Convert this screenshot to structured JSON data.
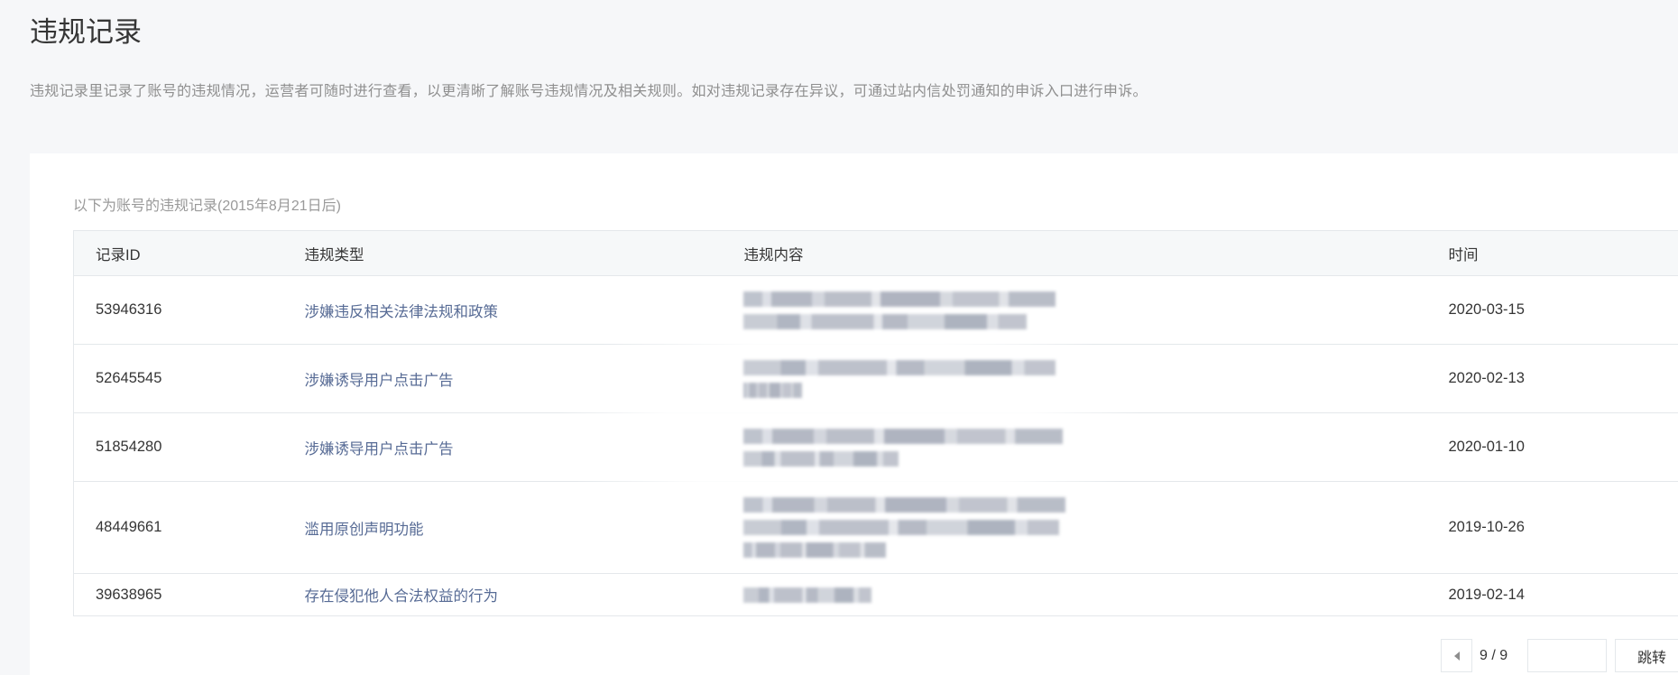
{
  "page": {
    "title": "违规记录",
    "description": "违规记录里记录了账号的违规情况，运营者可随时进行查看，以更清晰了解账号违规情况及相关规则。如对违规记录存在异议，可通过站内信处罚通知的申诉入口进行申诉。"
  },
  "records": {
    "caption": "以下为账号的违规记录(2015年8月21日后)",
    "columns": [
      "记录ID",
      "违规类型",
      "违规内容",
      "时间"
    ],
    "rows": [
      {
        "id": "53946316",
        "type": "涉嫌违反相关法律法规和政策",
        "date": "2020-03-15"
      },
      {
        "id": "52645545",
        "type": "涉嫌诱导用户点击广告",
        "date": "2020-02-13"
      },
      {
        "id": "51854280",
        "type": "涉嫌诱导用户点击广告",
        "date": "2020-01-10"
      },
      {
        "id": "48449661",
        "type": "滥用原创声明功能",
        "date": "2019-10-26"
      },
      {
        "id": "39638965",
        "type": "存在侵犯他人合法权益的行为",
        "date": "2019-02-14"
      }
    ]
  },
  "pagination": {
    "prev_icon": "caret-left-icon",
    "page_indicator": "9 / 9",
    "jump_label": "跳转"
  },
  "colors": {
    "text": "#353535",
    "muted": "#9a9a9a",
    "link": "#576b95",
    "page_background": "#f6f7f9",
    "border": "#e4e8eb"
  }
}
